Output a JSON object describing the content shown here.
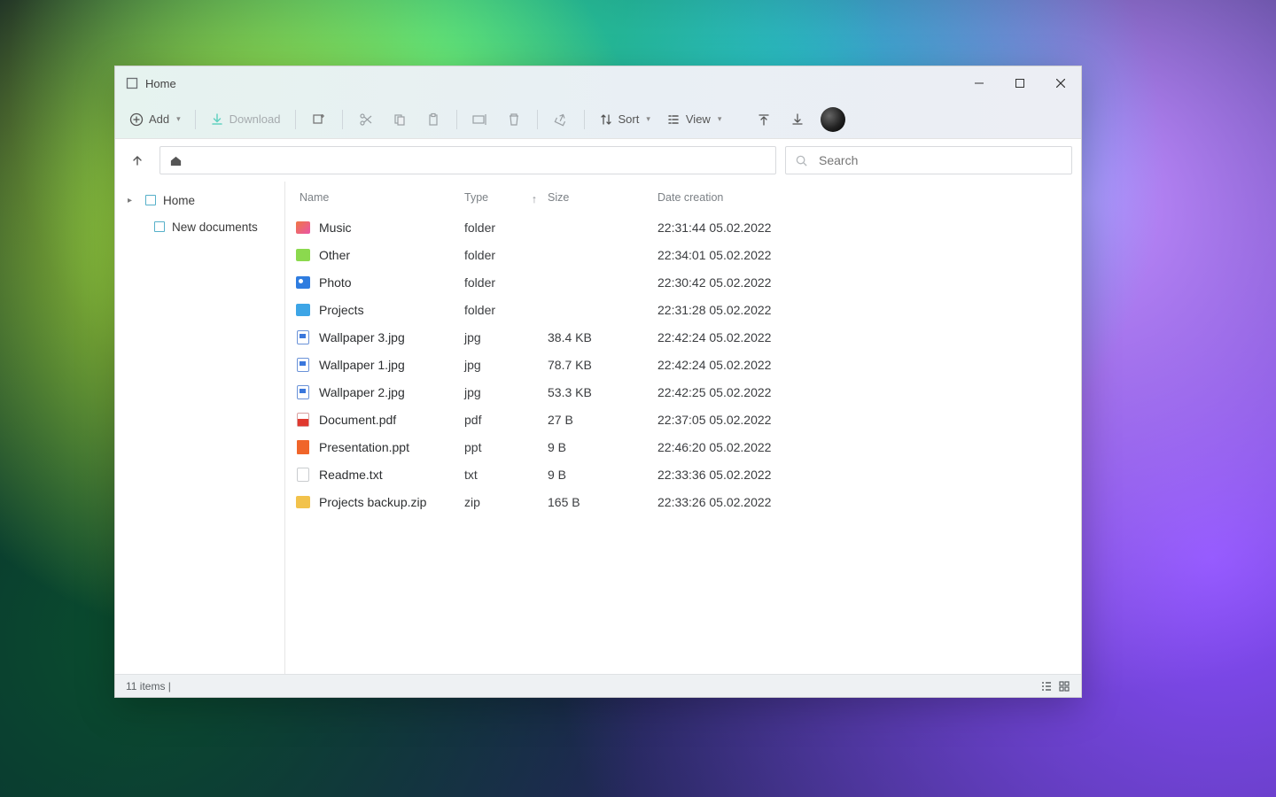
{
  "window": {
    "title": "Home"
  },
  "toolbar": {
    "add": "Add",
    "download": "Download",
    "sort": "Sort",
    "view": "View"
  },
  "search": {
    "placeholder": "Search"
  },
  "sidebar": {
    "items": [
      {
        "label": "Home"
      },
      {
        "label": "New documents"
      }
    ]
  },
  "columns": {
    "name": "Name",
    "type": "Type",
    "size": "Size",
    "date": "Date creation"
  },
  "files": [
    {
      "name": "Music",
      "type": "folder",
      "size": "",
      "date": "22:31:44 05.02.2022",
      "icon": "fld-music"
    },
    {
      "name": "Other",
      "type": "folder",
      "size": "",
      "date": "22:34:01 05.02.2022",
      "icon": "fld-other"
    },
    {
      "name": "Photo",
      "type": "folder",
      "size": "",
      "date": "22:30:42 05.02.2022",
      "icon": "fld-photo"
    },
    {
      "name": "Projects",
      "type": "folder",
      "size": "",
      "date": "22:31:28 05.02.2022",
      "icon": "fld-proj"
    },
    {
      "name": "Wallpaper 3.jpg",
      "type": "jpg",
      "size": "38.4 KB",
      "date": "22:42:24 05.02.2022",
      "icon": "f-img"
    },
    {
      "name": "Wallpaper 1.jpg",
      "type": "jpg",
      "size": "78.7 KB",
      "date": "22:42:24 05.02.2022",
      "icon": "f-img"
    },
    {
      "name": "Wallpaper 2.jpg",
      "type": "jpg",
      "size": "53.3 KB",
      "date": "22:42:25 05.02.2022",
      "icon": "f-img"
    },
    {
      "name": "Document.pdf",
      "type": "pdf",
      "size": "27 B",
      "date": "22:37:05 05.02.2022",
      "icon": "f-pdf"
    },
    {
      "name": "Presentation.ppt",
      "type": "ppt",
      "size": "9 B",
      "date": "22:46:20 05.02.2022",
      "icon": "f-ppt"
    },
    {
      "name": "Readme.txt",
      "type": "txt",
      "size": "9 B",
      "date": "22:33:36 05.02.2022",
      "icon": "f-txt"
    },
    {
      "name": "Projects backup.zip",
      "type": "zip",
      "size": "165 B",
      "date": "22:33:26 05.02.2022",
      "icon": "fld-zip"
    }
  ],
  "status": {
    "text": "11 items |"
  }
}
